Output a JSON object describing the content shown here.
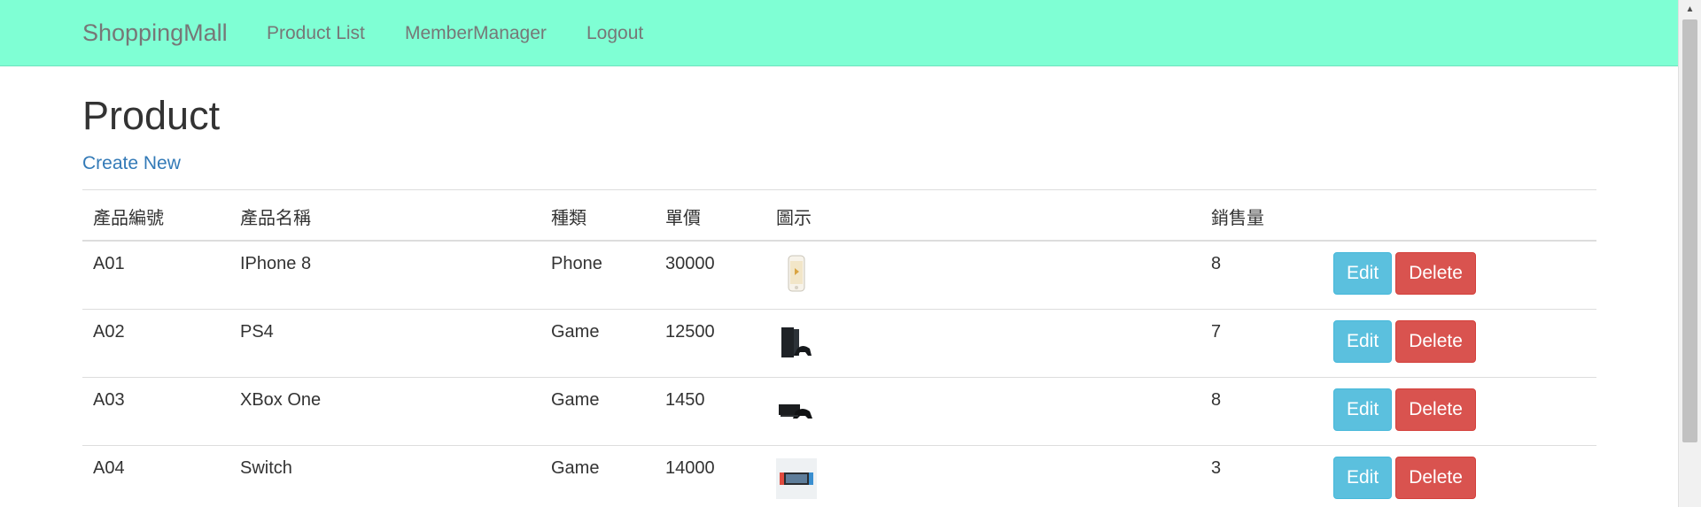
{
  "navbar": {
    "brand": "ShoppingMall",
    "links": [
      "Product List",
      "MemberManager",
      "Logout"
    ]
  },
  "page": {
    "title": "Product",
    "create_link": "Create New"
  },
  "table": {
    "headers": [
      "產品編號",
      "產品名稱",
      "種類",
      "單價",
      "圖示",
      "銷售量",
      ""
    ],
    "rows": [
      {
        "id": "A01",
        "name": "IPhone 8",
        "type": "Phone",
        "price": "30000",
        "image_icon": "iphone-image",
        "sales": "8"
      },
      {
        "id": "A02",
        "name": "PS4",
        "type": "Game",
        "price": "12500",
        "image_icon": "ps4-image",
        "sales": "7"
      },
      {
        "id": "A03",
        "name": "XBox One",
        "type": "Game",
        "price": "1450",
        "image_icon": "xbox-image",
        "sales": "8"
      },
      {
        "id": "A04",
        "name": "Switch",
        "type": "Game",
        "price": "14000",
        "image_icon": "switch-image",
        "sales": "3"
      }
    ],
    "edit_label": "Edit",
    "delete_label": "Delete"
  },
  "colors": {
    "navbar": "#7fffd4",
    "link": "#337ab7",
    "edit": "#5bc0de",
    "delete": "#d9534f"
  }
}
